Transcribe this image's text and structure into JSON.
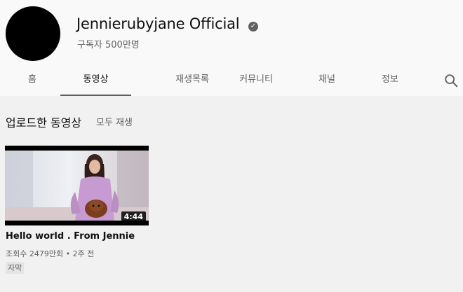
{
  "channel": {
    "name": "Jennierubyjane Official",
    "subscribers": "구독자 500만명",
    "verified_icon": "check-circle-icon"
  },
  "tabs": [
    {
      "label": "홈",
      "active": false
    },
    {
      "label": "동영상",
      "active": true
    },
    {
      "label": "재생목록",
      "active": false
    },
    {
      "label": "커뮤니티",
      "active": false
    },
    {
      "label": "채널",
      "active": false
    },
    {
      "label": "정보",
      "active": false
    }
  ],
  "search_icon": "search-icon",
  "section": {
    "title": "업로드한 동영상",
    "play_all": "모두 재생"
  },
  "video": {
    "duration": "4:44",
    "title": "Hello world . From Jennie",
    "meta": "조회수 2479만회 • 2주 전",
    "badge": "자막"
  },
  "colors": {
    "page_bg": "#f1f1f1",
    "header_bg": "#f9f9f9",
    "text_primary": "#0f0f0f",
    "text_secondary": "#606060"
  }
}
